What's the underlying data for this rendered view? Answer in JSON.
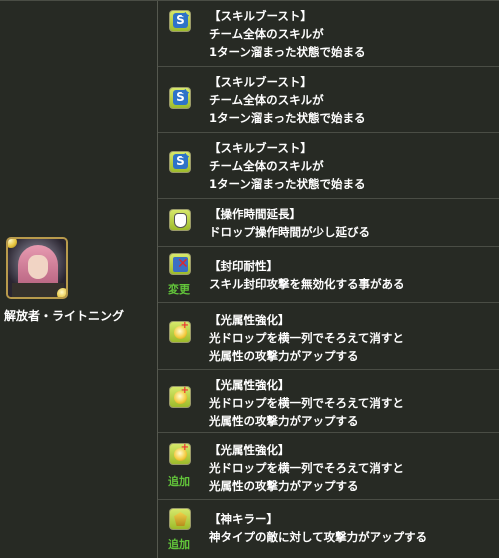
{
  "character": {
    "name": "解放者・ライトニング"
  },
  "awakenings": [
    {
      "icon": "skill-boost-icon",
      "kind": "sb",
      "title": "【スキルブースト】",
      "lines": [
        "チーム全体のスキルが",
        "1ターン溜まった状態で始まる"
      ],
      "badge": ""
    },
    {
      "icon": "skill-boost-icon",
      "kind": "sb",
      "title": "【スキルブースト】",
      "lines": [
        "チーム全体のスキルが",
        "1ターン溜まった状態で始まる"
      ],
      "badge": ""
    },
    {
      "icon": "skill-boost-icon",
      "kind": "sb",
      "title": "【スキルブースト】",
      "lines": [
        "チーム全体のスキルが",
        "1ターン溜まった状態で始まる"
      ],
      "badge": ""
    },
    {
      "icon": "hand-icon",
      "kind": "hand",
      "title": "【操作時間延長】",
      "lines": [
        "ドロップ操作時間が少し延びる"
      ],
      "badge": ""
    },
    {
      "icon": "seal-resist-icon",
      "kind": "seal",
      "title": "【封印耐性】",
      "lines": [
        "スキル封印攻撃を無効化する事がある"
      ],
      "badge": "変更"
    },
    {
      "icon": "light-enhance-icon",
      "kind": "light",
      "title": "【光属性強化】",
      "lines": [
        "光ドロップを横一列でそろえて消すと",
        "光属性の攻撃力がアップする"
      ],
      "badge": ""
    },
    {
      "icon": "light-enhance-icon",
      "kind": "light",
      "title": "【光属性強化】",
      "lines": [
        "光ドロップを横一列でそろえて消すと",
        "光属性の攻撃力がアップする"
      ],
      "badge": ""
    },
    {
      "icon": "light-enhance-icon",
      "kind": "light",
      "title": "【光属性強化】",
      "lines": [
        "光ドロップを横一列でそろえて消すと",
        "光属性の攻撃力がアップする"
      ],
      "badge": "追加"
    },
    {
      "icon": "god-killer-icon",
      "kind": "god",
      "title": "【神キラー】",
      "lines": [
        "神タイプの敵に対して攻撃力がアップする"
      ],
      "badge": "追加"
    }
  ]
}
